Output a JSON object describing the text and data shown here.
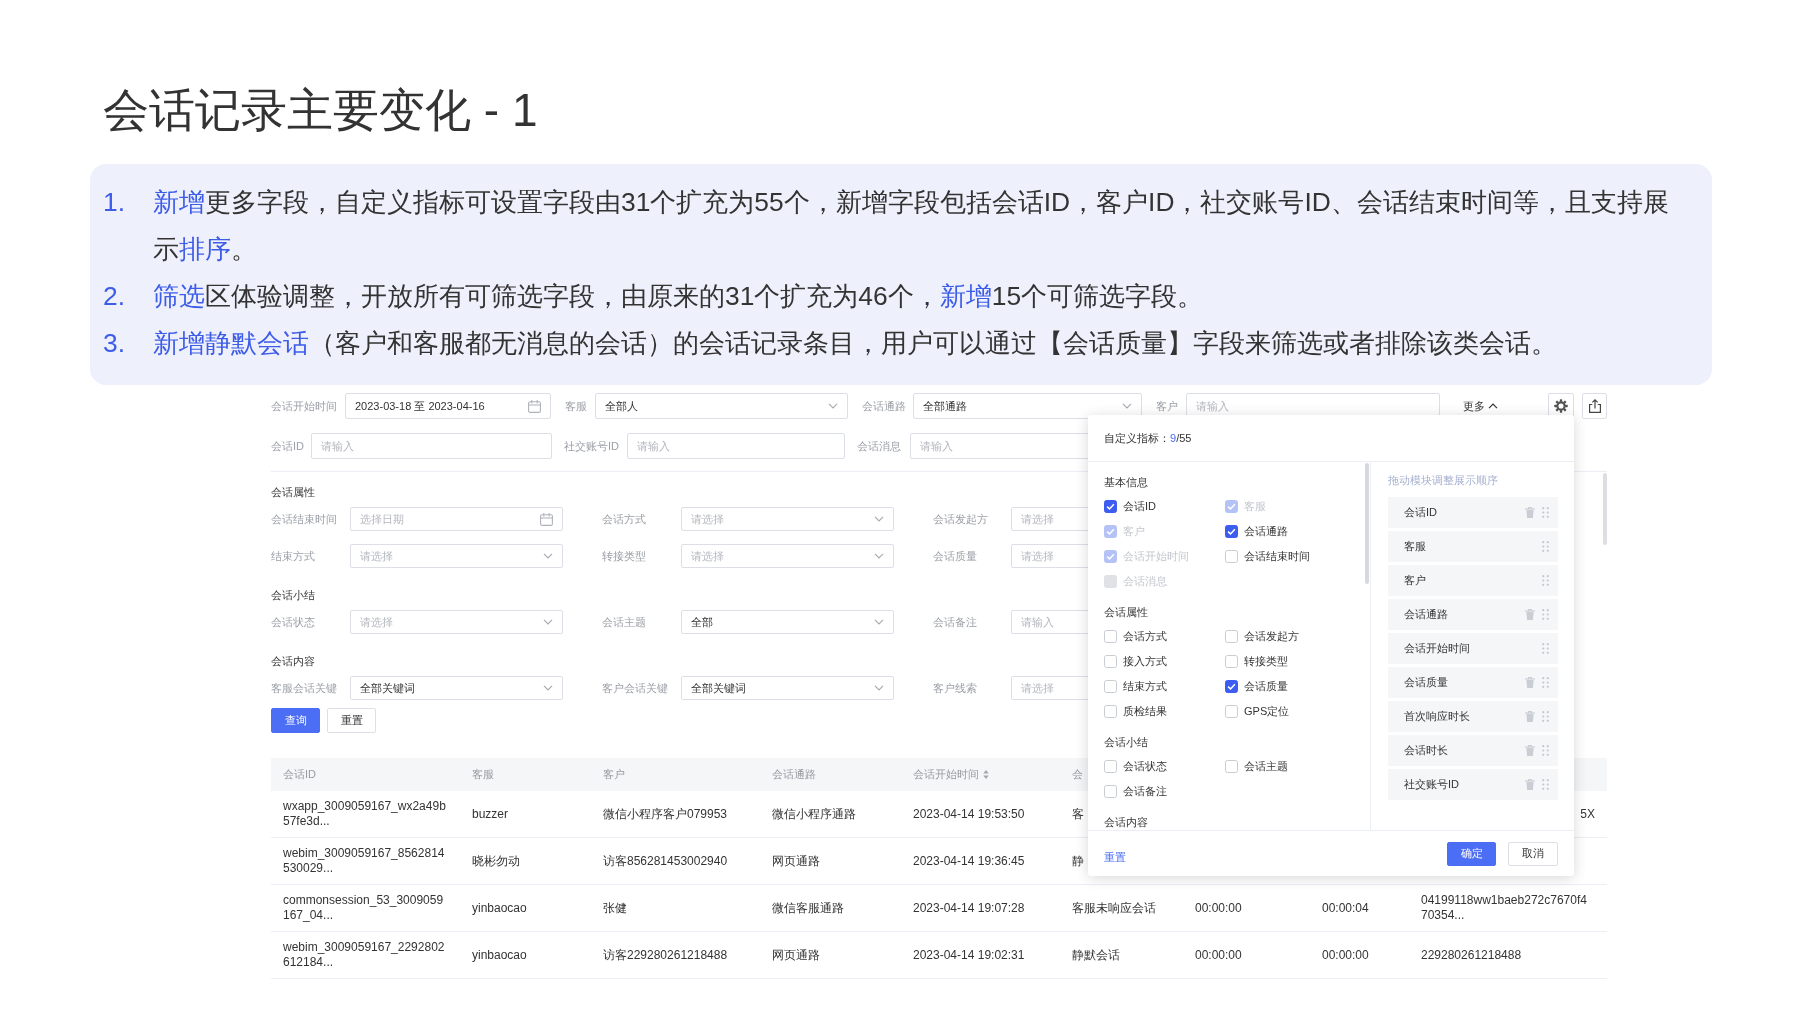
{
  "slide": {
    "title": "会话记录主要变化 - 1",
    "points": [
      {
        "number": "1.",
        "segments": [
          {
            "text": "新增",
            "highlight": true
          },
          {
            "text": "更多字段，自定义指标可设置字段由31个扩充为55个，新增字段包括会话ID，客户ID，社交账号ID、会话结束时间等，且支持展示",
            "highlight": false
          },
          {
            "text": "排序",
            "highlight": true
          },
          {
            "text": "。",
            "highlight": false
          }
        ]
      },
      {
        "number": "2.",
        "segments": [
          {
            "text": "筛选",
            "highlight": true
          },
          {
            "text": "区体验调整，开放所有可筛选字段，由原来的31个扩充为46个，",
            "highlight": false
          },
          {
            "text": "新增",
            "highlight": true
          },
          {
            "text": "15个可筛选字段。",
            "highlight": false
          }
        ]
      },
      {
        "number": "3.",
        "segments": [
          {
            "text": "新增静默会话",
            "highlight": true
          },
          {
            "text": "（客户和客服都无消息的会话）的会话记录条目，用户可以通过【会话质量】字段来筛选或者排除该类会话。",
            "highlight": false
          }
        ]
      }
    ]
  },
  "filters": {
    "rows": [
      [
        {
          "label": "会话开始时间",
          "kind": "date",
          "value": "2023-03-18 至 2023-04-16"
        },
        {
          "label": "客服",
          "kind": "select",
          "value": "全部人"
        },
        {
          "label": "会话通路",
          "kind": "select",
          "value": "全部通路"
        },
        {
          "label": "客户",
          "kind": "input",
          "placeholder": "请输入"
        }
      ],
      [
        {
          "label": "会话ID",
          "kind": "input",
          "placeholder": "请输入"
        },
        {
          "label": "社交账号ID",
          "kind": "input",
          "placeholder": "请输入"
        },
        {
          "label": "会话消息",
          "kind": "input",
          "placeholder": "请输入"
        }
      ]
    ],
    "more_toggle": {
      "label": "更多",
      "expanded": true
    },
    "sections": [
      {
        "title": "会话属性",
        "rows": [
          [
            {
              "label": "会话结束时间",
              "kind": "date",
              "placeholder": "选择日期"
            },
            {
              "label": "会话方式",
              "kind": "select",
              "placeholder": "请选择"
            },
            {
              "label": "会话发起方",
              "placeholder": "请选择"
            }
          ],
          [
            {
              "label": "结束方式",
              "kind": "select",
              "placeholder": "请选择"
            },
            {
              "label": "转接类型",
              "kind": "select",
              "placeholder": "请选择"
            },
            {
              "label": "会话质量",
              "placeholder": "请选择"
            }
          ]
        ]
      },
      {
        "title": "会话小结",
        "rows": [
          [
            {
              "label": "会话状态",
              "kind": "select",
              "placeholder": "请选择"
            },
            {
              "label": "会话主题",
              "kind": "select",
              "value": "全部"
            },
            {
              "label": "会话备注",
              "placeholder": "请输入"
            }
          ]
        ]
      },
      {
        "title": "会话内容",
        "rows": [
          [
            {
              "label": "客服会话关键",
              "kind": "select",
              "value": "全部关键词"
            },
            {
              "label": "客户会话关键",
              "kind": "select",
              "value": "全部关键词"
            },
            {
              "label": "客户线索",
              "placeholder": "请选择"
            }
          ]
        ]
      }
    ]
  },
  "actions": [
    {
      "label": "查询",
      "primary": true
    },
    {
      "label": "重置",
      "primary": false
    }
  ],
  "table": {
    "columns": [
      {
        "label": "会话ID",
        "sortable": false
      },
      {
        "label": "客服",
        "sortable": false
      },
      {
        "label": "客户",
        "sortable": false
      },
      {
        "label": "会话通路",
        "sortable": false
      },
      {
        "label": "会话开始时间",
        "sortable": true
      },
      {
        "label": "会",
        "sortable": false
      }
    ],
    "rows": [
      {
        "cells": [
          "wxapp_3009059167_wx2a49b\n57fe3d...",
          "buzzer",
          "微信小程序客户079953",
          "微信小程序通路",
          "2023-04-14 19:53:50",
          "客",
          null,
          null,
          "5X"
        ]
      },
      {
        "cells": [
          "webim_3009059167_8562814\n530029...",
          "晓彬勿动",
          "访客856281453002940",
          "网页通路",
          "2023-04-14 19:36:45",
          "静",
          null,
          null,
          null
        ]
      },
      {
        "cells": [
          "commonsession_53_3009059\n167_04...",
          "yinbaocao",
          "张健",
          "微信客服通路",
          "2023-04-14 19:07:28",
          "客服未响应会话",
          "00:00:00",
          "00:00:04",
          "04199118ww1baeb272c7670f4\n70354..."
        ]
      },
      {
        "cells": [
          "webim_3009059167_2292802\n612184...",
          "yinbaocao",
          "访客229280261218488",
          "网页通路",
          "2023-04-14 19:02:31",
          "静默会话",
          "00:00:00",
          "00:00:00",
          "229280261218488"
        ]
      }
    ]
  },
  "column_settings": {
    "title": "自定义指标：",
    "count": "9",
    "total": "/55",
    "groups": [
      {
        "title": "基本信息",
        "options": [
          {
            "label": "会话ID",
            "checked": true,
            "disabled": false
          },
          {
            "label": "客服",
            "checked": true,
            "disabled": true
          },
          {
            "label": "客户",
            "checked": true,
            "disabled": true
          },
          {
            "label": "会话通路",
            "checked": true,
            "disabled": false
          },
          {
            "label": "会话开始时间",
            "checked": true,
            "disabled": true
          },
          {
            "label": "会话结束时间",
            "checked": false,
            "disabled": false
          },
          {
            "label": "会话消息",
            "checked": false,
            "disabled": true
          }
        ]
      },
      {
        "title": "会话属性",
        "options": [
          {
            "label": "会话方式",
            "checked": false,
            "disabled": false
          },
          {
            "label": "会话发起方",
            "checked": false,
            "disabled": false
          },
          {
            "label": "接入方式",
            "checked": false,
            "disabled": false
          },
          {
            "label": "转接类型",
            "checked": false,
            "disabled": false
          },
          {
            "label": "结束方式",
            "checked": false,
            "disabled": false
          },
          {
            "label": "会话质量",
            "checked": true,
            "disabled": false
          },
          {
            "label": "质检结果",
            "checked": false,
            "disabled": false
          },
          {
            "label": "GPS定位",
            "checked": false,
            "disabled": false
          }
        ]
      },
      {
        "title": "会话小结",
        "options": [
          {
            "label": "会话状态",
            "checked": false,
            "disabled": false
          },
          {
            "label": "会话主题",
            "checked": false,
            "disabled": false
          },
          {
            "label": "会话备注",
            "checked": false,
            "disabled": false
          }
        ]
      },
      {
        "title": "会话内容"
      }
    ],
    "order_hint": "拖动模块调整展示顺序",
    "order_items": [
      {
        "label": "会话ID",
        "removable": true
      },
      {
        "label": "客服",
        "removable": false
      },
      {
        "label": "客户",
        "removable": false
      },
      {
        "label": "会话通路",
        "removable": true
      },
      {
        "label": "会话开始时间",
        "removable": false
      },
      {
        "label": "会话质量",
        "removable": true
      },
      {
        "label": "首次响应时长",
        "removable": true
      },
      {
        "label": "会话时长",
        "removable": true
      },
      {
        "label": "社交账号ID",
        "removable": true
      }
    ],
    "reset": "重置",
    "confirm": "确定",
    "cancel": "取消"
  }
}
